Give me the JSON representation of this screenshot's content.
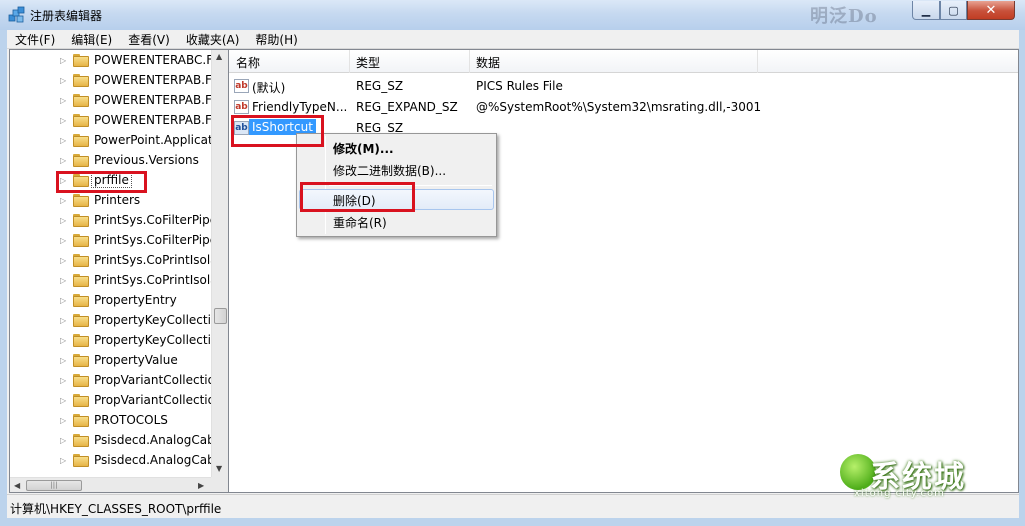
{
  "window": {
    "title": "注册表编辑器",
    "background_watermark": "明泛Do"
  },
  "menubar": {
    "items": [
      "文件(F)",
      "编辑(E)",
      "查看(V)",
      "收藏夹(A)",
      "帮助(H)"
    ]
  },
  "tree": {
    "items": [
      "POWERENTERABC.F",
      "POWERENTERPAB.F",
      "POWERENTERPAB.F",
      "POWERENTERPAB.F",
      "PowerPoint.Applicat",
      "Previous.Versions",
      "prffile",
      "Printers",
      "PrintSys.CoFilterPipe",
      "PrintSys.CoFilterPipe",
      "PrintSys.CoPrintIsola",
      "PrintSys.CoPrintIsola",
      "PropertyEntry",
      "PropertyKeyCollecti",
      "PropertyKeyCollecti",
      "PropertyValue",
      "PropVariantCollectio",
      "PropVariantCollectio",
      "PROTOCOLS",
      "Psisdecd.AnalogCab",
      "Psisdecd.AnalogCab"
    ],
    "selected": "prffile"
  },
  "list": {
    "columns": [
      "名称",
      "类型",
      "数据"
    ],
    "rows": [
      {
        "name": "(默认)",
        "type": "REG_SZ",
        "data": "PICS Rules File",
        "icon": "ab"
      },
      {
        "name": "FriendlyTypeN...",
        "type": "REG_EXPAND_SZ",
        "data": "@%SystemRoot%\\System32\\msrating.dll,-3001",
        "icon": "ab"
      },
      {
        "name": "IsShortcut",
        "type": "REG_SZ",
        "data": "",
        "icon": "ab"
      }
    ]
  },
  "context_menu": {
    "items": [
      "修改(M)...",
      "修改二进制数据(B)...",
      "删除(D)",
      "重命名(R)"
    ],
    "highlighted": "删除(D)"
  },
  "statusbar": {
    "path": "计算机\\HKEY_CLASSES_ROOT\\prffile"
  },
  "watermark": {
    "text": "系统城",
    "url": "xitong city.com"
  }
}
